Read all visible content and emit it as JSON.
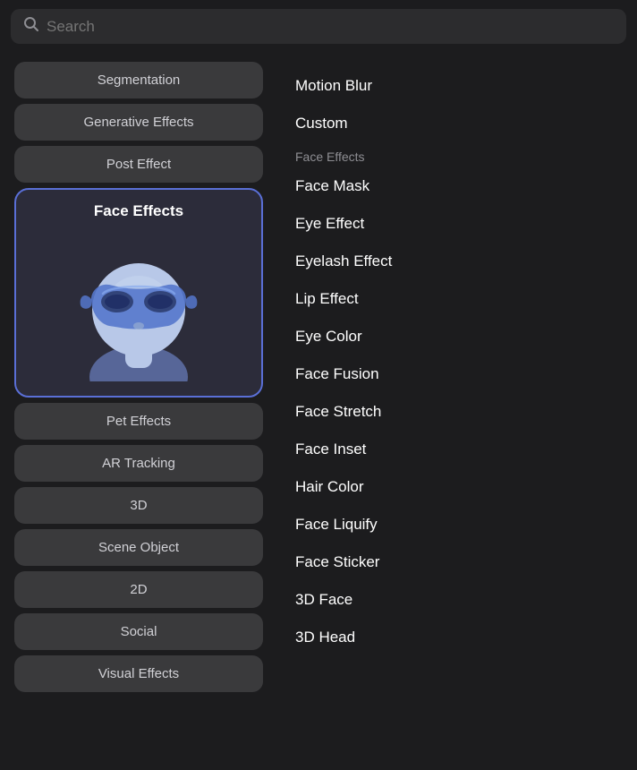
{
  "search": {
    "placeholder": "Search"
  },
  "sidebar": {
    "items_top": [
      {
        "id": "segmentation",
        "label": "Segmentation"
      },
      {
        "id": "generative-effects",
        "label": "Generative Effects"
      },
      {
        "id": "post-effect",
        "label": "Post Effect"
      }
    ],
    "active_item": {
      "id": "face-effects",
      "label": "Face Effects"
    },
    "items_bottom": [
      {
        "id": "pet-effects",
        "label": "Pet Effects"
      },
      {
        "id": "ar-tracking",
        "label": "AR Tracking"
      },
      {
        "id": "3d",
        "label": "3D"
      },
      {
        "id": "scene-object",
        "label": "Scene Object"
      },
      {
        "id": "2d",
        "label": "2D"
      },
      {
        "id": "social",
        "label": "Social"
      },
      {
        "id": "visual-effects",
        "label": "Visual Effects"
      }
    ]
  },
  "content": {
    "menu_items_top": [
      {
        "id": "motion-blur",
        "label": "Motion Blur"
      },
      {
        "id": "custom",
        "label": "Custom"
      }
    ],
    "section_header": "Face Effects",
    "menu_items": [
      {
        "id": "face-mask",
        "label": "Face Mask"
      },
      {
        "id": "eye-effect",
        "label": "Eye Effect"
      },
      {
        "id": "eyelash-effect",
        "label": "Eyelash Effect"
      },
      {
        "id": "lip-effect",
        "label": "Lip Effect"
      },
      {
        "id": "eye-color",
        "label": "Eye Color"
      },
      {
        "id": "face-fusion",
        "label": "Face Fusion"
      },
      {
        "id": "face-stretch",
        "label": "Face Stretch"
      },
      {
        "id": "face-inset",
        "label": "Face Inset"
      },
      {
        "id": "hair-color",
        "label": "Hair Color"
      },
      {
        "id": "face-liquify",
        "label": "Face Liquify"
      },
      {
        "id": "face-sticker",
        "label": "Face Sticker"
      },
      {
        "id": "3d-face",
        "label": "3D Face"
      },
      {
        "id": "3d-head",
        "label": "3D Head"
      }
    ]
  },
  "colors": {
    "active_border": "#5a6fd6",
    "active_bg": "#2c2c3a",
    "body_bg": "#1c1c1e",
    "item_bg": "#3a3a3c",
    "section_color": "#8e8e93",
    "face_body": "#8899cc",
    "face_mask": "#6a8fd8",
    "face_head": "#b0bedd"
  }
}
